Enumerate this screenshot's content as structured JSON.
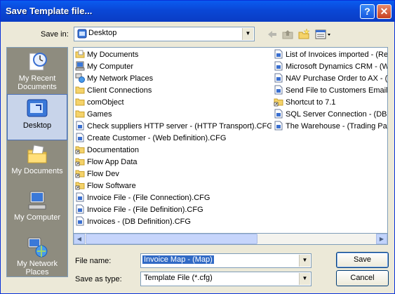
{
  "window": {
    "title": "Save Template file...",
    "help_icon": "help-icon",
    "close_icon": "close-icon"
  },
  "save_in": {
    "label": "Save in:",
    "value": "Desktop",
    "icon": "desktop-icon"
  },
  "toolbar": {
    "icons": [
      "back-icon",
      "up-folder-icon",
      "new-folder-icon",
      "views-menu-icon"
    ]
  },
  "places": [
    {
      "label": "My Recent Documents",
      "icon": "recent-documents-icon"
    },
    {
      "label": "Desktop",
      "icon": "desktop-icon",
      "selected": true
    },
    {
      "label": "My Documents",
      "icon": "my-documents-icon"
    },
    {
      "label": "My Computer",
      "icon": "my-computer-icon"
    },
    {
      "label": "My Network Places",
      "icon": "network-places-icon"
    }
  ],
  "files_col1": [
    {
      "name": "My Documents",
      "icon": "my-documents-icon"
    },
    {
      "name": "My Computer",
      "icon": "my-computer-icon"
    },
    {
      "name": "My Network Places",
      "icon": "network-places-icon"
    },
    {
      "name": "Client Connections",
      "icon": "folder-icon"
    },
    {
      "name": "comObject",
      "icon": "folder-icon"
    },
    {
      "name": "Games",
      "icon": "folder-icon"
    },
    {
      "name": "Check suppliers HTTP server - (HTTP Transport).CFG",
      "icon": "cfg-file-icon"
    },
    {
      "name": "Create Customer - (Web Definition).CFG",
      "icon": "cfg-file-icon"
    },
    {
      "name": "Documentation",
      "icon": "shortcut-folder-icon"
    },
    {
      "name": "Flow App Data",
      "icon": "shortcut-folder-icon"
    },
    {
      "name": "Flow Dev",
      "icon": "shortcut-folder-icon"
    },
    {
      "name": "Flow Software",
      "icon": "shortcut-folder-icon"
    },
    {
      "name": "Invoice File - (File Connection).CFG",
      "icon": "cfg-file-icon"
    },
    {
      "name": "Invoice File - (File Definition).CFG",
      "icon": "cfg-file-icon"
    },
    {
      "name": "Invoices - (DB Definition).CFG",
      "icon": "cfg-file-icon"
    }
  ],
  "files_col2": [
    {
      "name": "List of Invoices imported - (Rep",
      "icon": "cfg-file-icon"
    },
    {
      "name": "Microsoft Dynamics CRM - (We",
      "icon": "cfg-file-icon"
    },
    {
      "name": "NAV Purchase Order to AX - (A",
      "icon": "cfg-file-icon"
    },
    {
      "name": "Send File to Customers Email -",
      "icon": "cfg-file-icon"
    },
    {
      "name": "Shortcut to 7.1",
      "icon": "shortcut-folder-icon"
    },
    {
      "name": "SQL Server Connection - (DB C",
      "icon": "cfg-file-icon"
    },
    {
      "name": "The Warehouse - (Trading Par",
      "icon": "cfg-file-icon"
    }
  ],
  "file_name": {
    "label": "File name:",
    "value": "Invoice Map - (Map)"
  },
  "save_as_type": {
    "label": "Save as type:",
    "value": "Template File (*.cfg)"
  },
  "buttons": {
    "save": "Save",
    "cancel": "Cancel"
  },
  "colors": {
    "titlebar": "#0a47d6",
    "places_bg": "#8e8c7f",
    "selection": "#316ac5"
  }
}
